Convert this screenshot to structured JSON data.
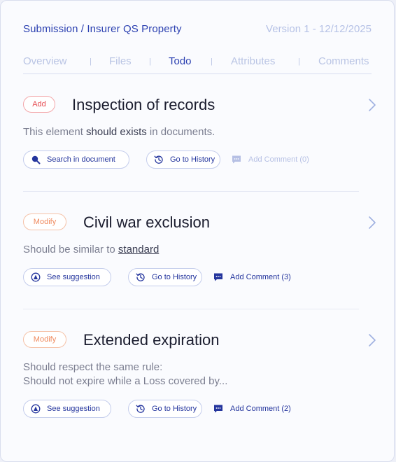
{
  "header": {
    "breadcrumb": "Submission / Insurer QS Property",
    "version": "Version 1 - 12/12/2025"
  },
  "tabs": [
    {
      "label": "Overview",
      "active": false
    },
    {
      "label": "Files",
      "active": false
    },
    {
      "label": "Todo",
      "active": true
    },
    {
      "label": "Attributes",
      "active": false
    },
    {
      "label": "Comments",
      "active": false
    }
  ],
  "tab_separator": "|",
  "items": [
    {
      "badge": "Add",
      "title": "Inspection of records",
      "desc_pre": "This element ",
      "desc_strong": "should exists",
      "desc_post": " in documents.",
      "primary_action": "Search in document",
      "history_action": "Go to History",
      "comment_action": "Add Comment (0)"
    },
    {
      "badge": "Modify",
      "title": "Civil war exclusion",
      "desc_pre": "Should be similar to ",
      "desc_link": "standard",
      "primary_action": "See suggestion",
      "history_action": "Go to History",
      "comment_action": "Add Comment (3)"
    },
    {
      "badge": "Modify",
      "title": "Extended expiration",
      "desc_line1": "Should respect the same rule:",
      "desc_line2": "Should not expire while a Loss covered by...",
      "primary_action": "See suggestion",
      "history_action": "Go to History",
      "comment_action": "Add Comment (2)"
    }
  ],
  "colors": {
    "accent": "#2a3fb0",
    "add_badge": "#e5484d",
    "modify_badge": "#ef8a5e",
    "muted": "#b9c4e4"
  },
  "icons": [
    "search-icon",
    "suggestion-icon",
    "history-icon",
    "comment-icon",
    "chevron-right-icon"
  ]
}
